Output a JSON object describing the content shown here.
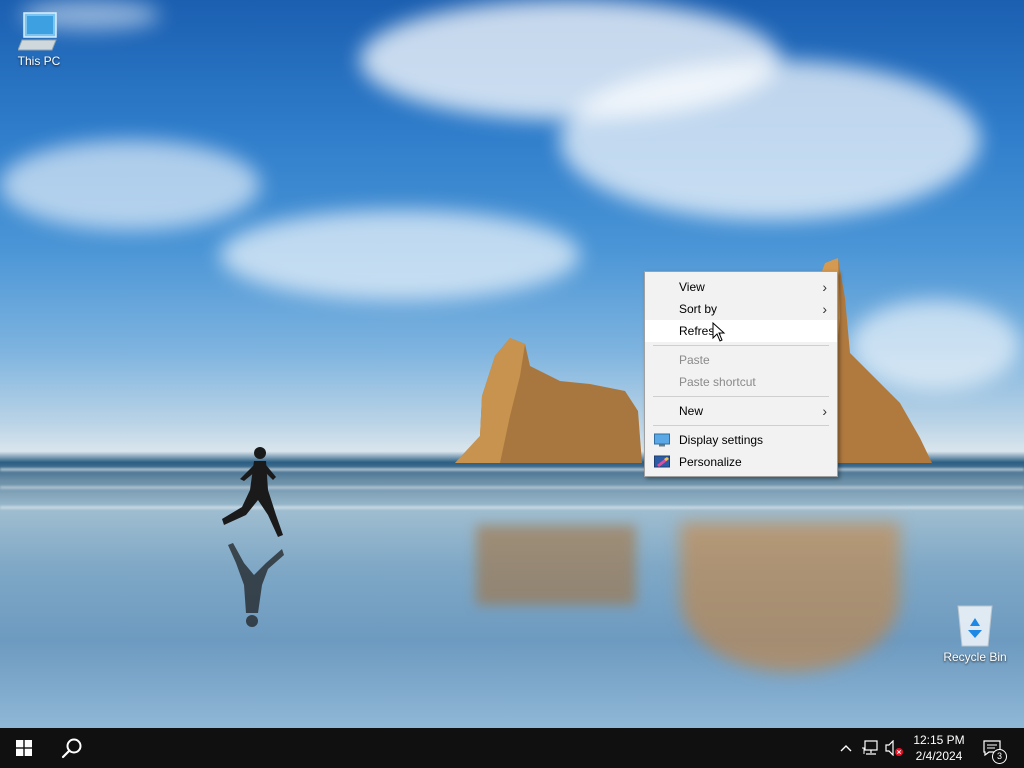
{
  "desktop": {
    "icons": [
      {
        "label": "This PC",
        "icon": "this-pc-icon"
      },
      {
        "label": "Recycle Bin",
        "icon": "recycle-bin-icon"
      }
    ]
  },
  "context_menu": {
    "items": [
      {
        "label": "View",
        "submenu": true,
        "enabled": true
      },
      {
        "label": "Sort by",
        "submenu": true,
        "enabled": true
      },
      {
        "label": "Refresh",
        "enabled": true,
        "highlighted": true
      },
      {
        "label": "Paste",
        "enabled": false
      },
      {
        "label": "Paste shortcut",
        "enabled": false
      },
      {
        "label": "New",
        "submenu": true,
        "enabled": true
      },
      {
        "label": "Display settings",
        "icon": "display-settings-icon",
        "enabled": true
      },
      {
        "label": "Personalize",
        "icon": "personalize-icon",
        "enabled": true
      }
    ]
  },
  "taskbar": {
    "start_icon": "windows-logo-icon",
    "search_icon": "search-icon",
    "tray": {
      "icons": [
        "chevron-up-icon",
        "network-icon",
        "volume-muted-icon"
      ],
      "clock": {
        "time": "12:15 PM",
        "date": "2/4/2024"
      },
      "notification_count": "3"
    }
  },
  "colors": {
    "taskbar": "#101010",
    "menu_bg": "#f2f2f2",
    "menu_disabled_text": "#8a8a8a"
  }
}
